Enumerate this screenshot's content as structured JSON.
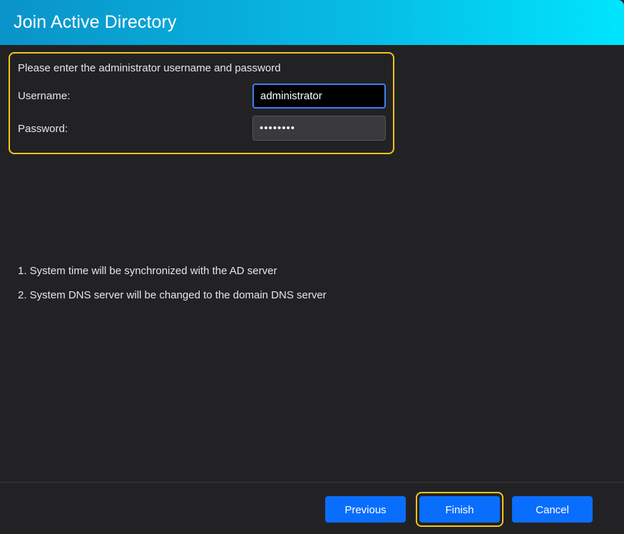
{
  "dialog": {
    "title": "Join Active Directory"
  },
  "credentials": {
    "instruction": "Please enter the administrator username and password",
    "username_label": "Username:",
    "username_value": "administrator",
    "password_label": "Password:",
    "password_value": "••••••••"
  },
  "notes": [
    "1. System time will be synchronized with the AD server",
    "2. System DNS server will be changed to the domain DNS server"
  ],
  "buttons": {
    "previous": "Previous",
    "finish": "Finish",
    "cancel": "Cancel"
  },
  "colors": {
    "accent_blue": "#0a6efd",
    "highlight_yellow": "#f5c518",
    "title_gradient_start": "#0a93c9",
    "title_gradient_end": "#00e5fd"
  }
}
